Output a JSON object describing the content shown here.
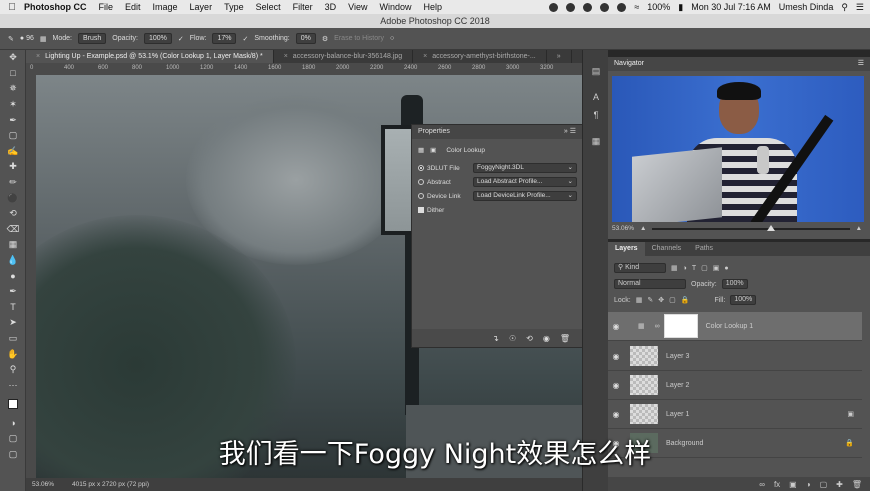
{
  "menubar": {
    "app": "Photoshop CC",
    "items": [
      "File",
      "Edit",
      "Image",
      "Layer",
      "Type",
      "Select",
      "Filter",
      "3D",
      "View",
      "Window",
      "Help"
    ],
    "battery": "100%",
    "datetime": "Mon 30 Jul  7:16 AM",
    "user": "Umesh Dinda"
  },
  "window_title": "Adobe Photoshop CC 2018",
  "options": {
    "brush_size": "96",
    "mode_label": "Mode:",
    "mode_value": "Brush",
    "opacity_label": "Opacity:",
    "opacity_value": "100%",
    "flow_label": "Flow:",
    "flow_value": "17%",
    "smoothing_label": "Smoothing:",
    "smoothing_value": "0%",
    "erase_history": "Erase to History"
  },
  "tabs": [
    {
      "label": "Lighting Up - Example.psd @ 53.1% (Color Lookup 1, Layer Mask/8) *",
      "active": true
    },
    {
      "label": "accessory-balance-blur-356148.jpg",
      "active": false
    },
    {
      "label": "accessory-amethyst-birthstone-...",
      "active": false
    }
  ],
  "ruler": [
    "0",
    "400",
    "600",
    "800",
    "1000",
    "1200",
    "1400",
    "1600",
    "1800",
    "2000",
    "2200",
    "2400",
    "2600",
    "2800",
    "3000",
    "3200"
  ],
  "status": {
    "zoom": "53.06%",
    "doc": "4015 px x 2720 px (72 ppi)"
  },
  "properties": {
    "title": "Properties",
    "subtitle": "Color Lookup",
    "rows": [
      {
        "label": "3DLUT File",
        "value": "FoggyNight.3DL",
        "selected": true
      },
      {
        "label": "Abstract",
        "value": "Load Abstract Profile...",
        "selected": false
      },
      {
        "label": "Device Link",
        "value": "Load DeviceLink Profile...",
        "selected": false
      }
    ],
    "dither": "Dither"
  },
  "navigator": {
    "title": "Navigator",
    "zoom": "53.06%"
  },
  "layers_panel": {
    "tabs": [
      "Layers",
      "Channels",
      "Paths"
    ],
    "kind": "Kind",
    "blend": "Normal",
    "opacity_label": "Opacity:",
    "opacity_value": "100%",
    "lock_label": "Lock:",
    "fill_label": "Fill:",
    "fill_value": "100%",
    "layers": [
      "Color Lookup 1",
      "Layer 3",
      "Layer 2",
      "Layer 1",
      "Background"
    ]
  },
  "subtitle": "我们看一下Foggy Night效果怎么样"
}
